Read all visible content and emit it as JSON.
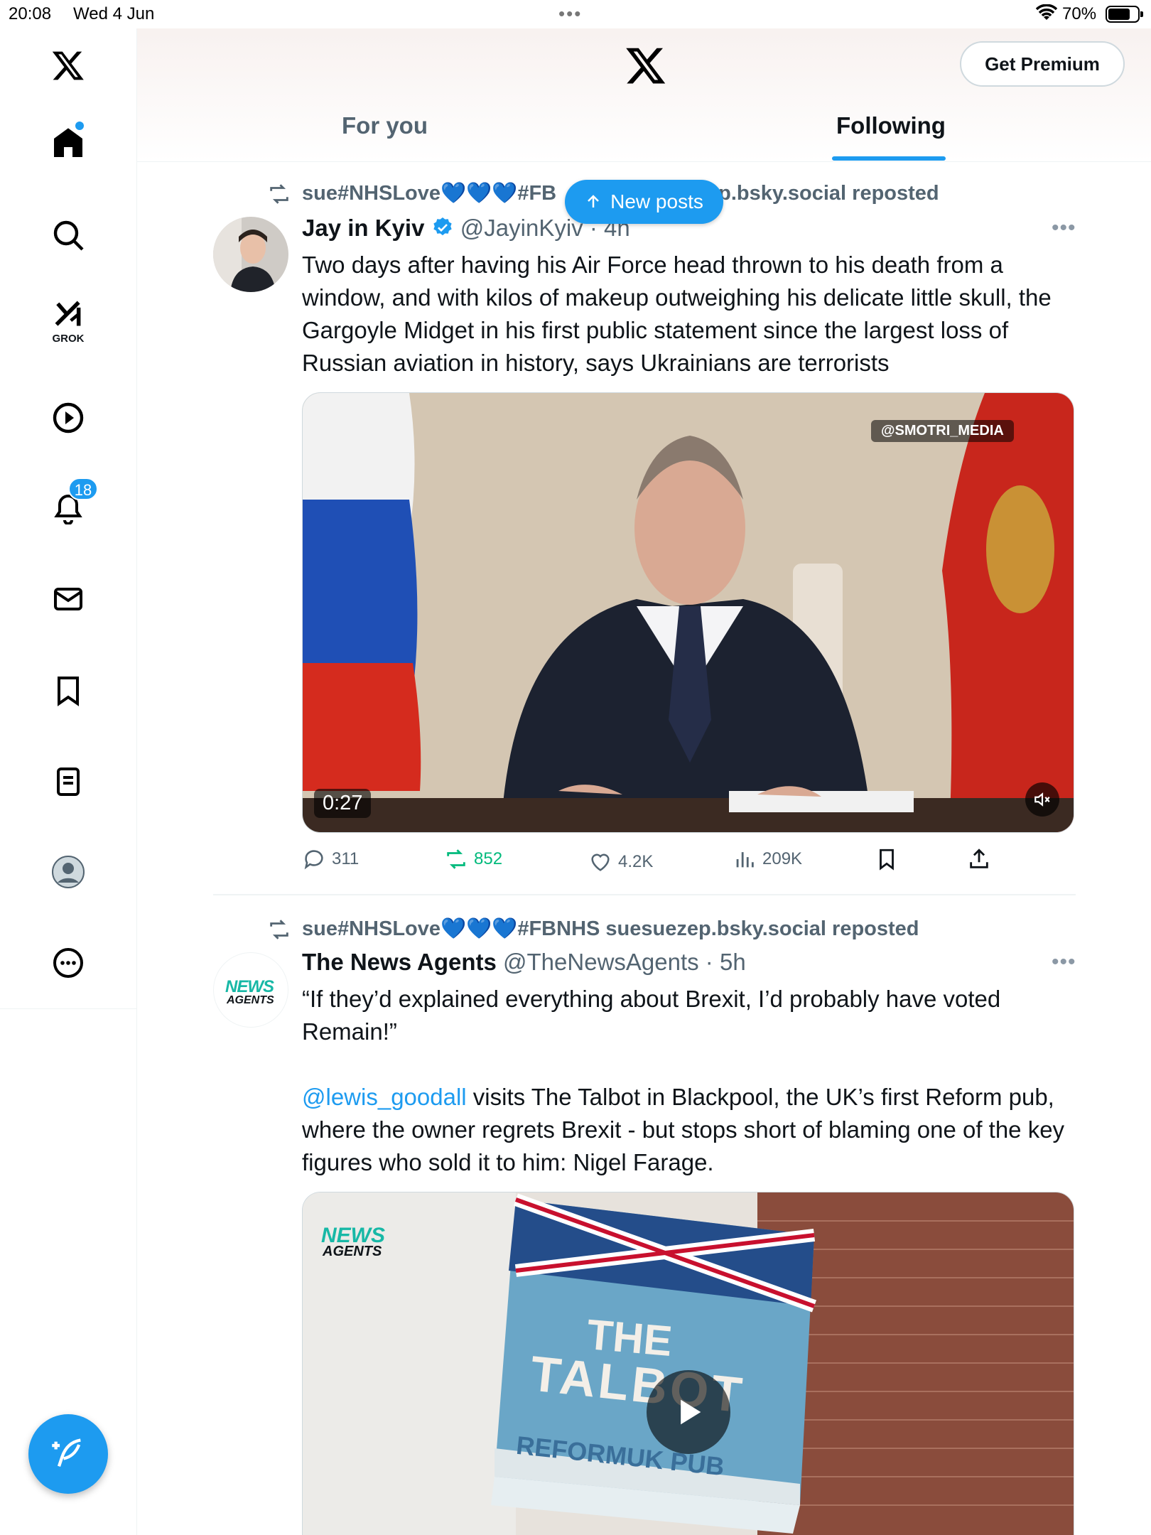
{
  "status_bar": {
    "time": "20:08",
    "date": "Wed 4 Jun",
    "battery": "70%"
  },
  "header": {
    "premium_label": "Get Premium",
    "tabs": [
      {
        "label": "For you",
        "active": false
      },
      {
        "label": "Following",
        "active": true
      }
    ]
  },
  "sidebar": {
    "items": [
      {
        "icon": "home-icon",
        "has_dot": true
      },
      {
        "icon": "search-icon"
      },
      {
        "icon": "grok-icon",
        "label": "GROK"
      },
      {
        "icon": "video-play-icon"
      },
      {
        "icon": "bell-icon",
        "badge": "18"
      },
      {
        "icon": "mail-icon"
      },
      {
        "icon": "bookmark-icon"
      },
      {
        "icon": "lists-icon"
      },
      {
        "icon": "profile-icon"
      },
      {
        "icon": "more-icon"
      }
    ]
  },
  "new_posts_label": "New posts",
  "posts": [
    {
      "repost_by": "sue#NHSLove💙💙💙#FB",
      "repost_suffix": "p.bsky.social reposted",
      "author_name": "Jay in Kyiv",
      "verified": true,
      "handle": "@JayinKyiv",
      "time": "4h",
      "text": "Two days after having his Air Force head thrown to his death from a window, and with kilos of makeup outweighing his delicate little skull, the Gargoyle Midget in his first public statement since the largest loss of Russian aviation in history, says Ukrainians are terrorists",
      "media": {
        "duration": "0:27",
        "watermark": "@SMOTRI_MEDIA"
      },
      "stats": {
        "replies": "311",
        "reposts": "852",
        "likes": "4.2K",
        "views": "209K"
      }
    },
    {
      "repost_by": "sue#NHSLove💙💙💙#FBNHS suesuezep.bsky.social reposted",
      "author_name": "The News Agents",
      "avatar_text_1": "NEWS",
      "avatar_text_2": "AGENTS",
      "handle": "@TheNewsAgents",
      "time": "5h",
      "text_line1": "“If they’d explained everything about Brexit, I’d probably have voted Remain!”",
      "mention": "@lewis_goodall",
      "text_line2": " visits The Talbot in Blackpool, the UK’s first Reform pub, where the owner regrets Brexit - but stops short of blaming one of the key figures who sold it to him: Nigel Farage.",
      "media": {
        "logo_1": "NEWS",
        "logo_2": "AGENTS",
        "sign_1": "THE",
        "sign_2": "TALBOT",
        "sign_3": "REFORMUK PUB"
      }
    }
  ]
}
